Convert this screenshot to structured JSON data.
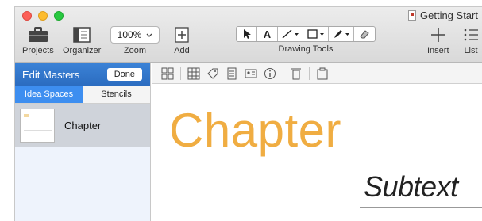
{
  "window": {
    "document_title": "Getting Start"
  },
  "toolbar": {
    "projects_label": "Projects",
    "organizer_label": "Organizer",
    "zoom_value": "100%",
    "zoom_label": "Zoom",
    "add_label": "Add",
    "drawing_tools_label": "Drawing Tools",
    "insert_label": "Insert",
    "list_label": "List"
  },
  "sidebar": {
    "title": "Edit Masters",
    "done_label": "Done",
    "tabs": [
      {
        "label": "Idea Spaces",
        "active": true
      },
      {
        "label": "Stencils",
        "active": false
      }
    ],
    "masters": [
      {
        "label": "Chapter"
      }
    ]
  },
  "canvas": {
    "heading": "Chapter",
    "subtext": "Subtext",
    "heading_color": "#f0ad42"
  },
  "colors": {
    "sidebar_header": "#2f74c9",
    "active_tab": "#3d8ef0"
  }
}
